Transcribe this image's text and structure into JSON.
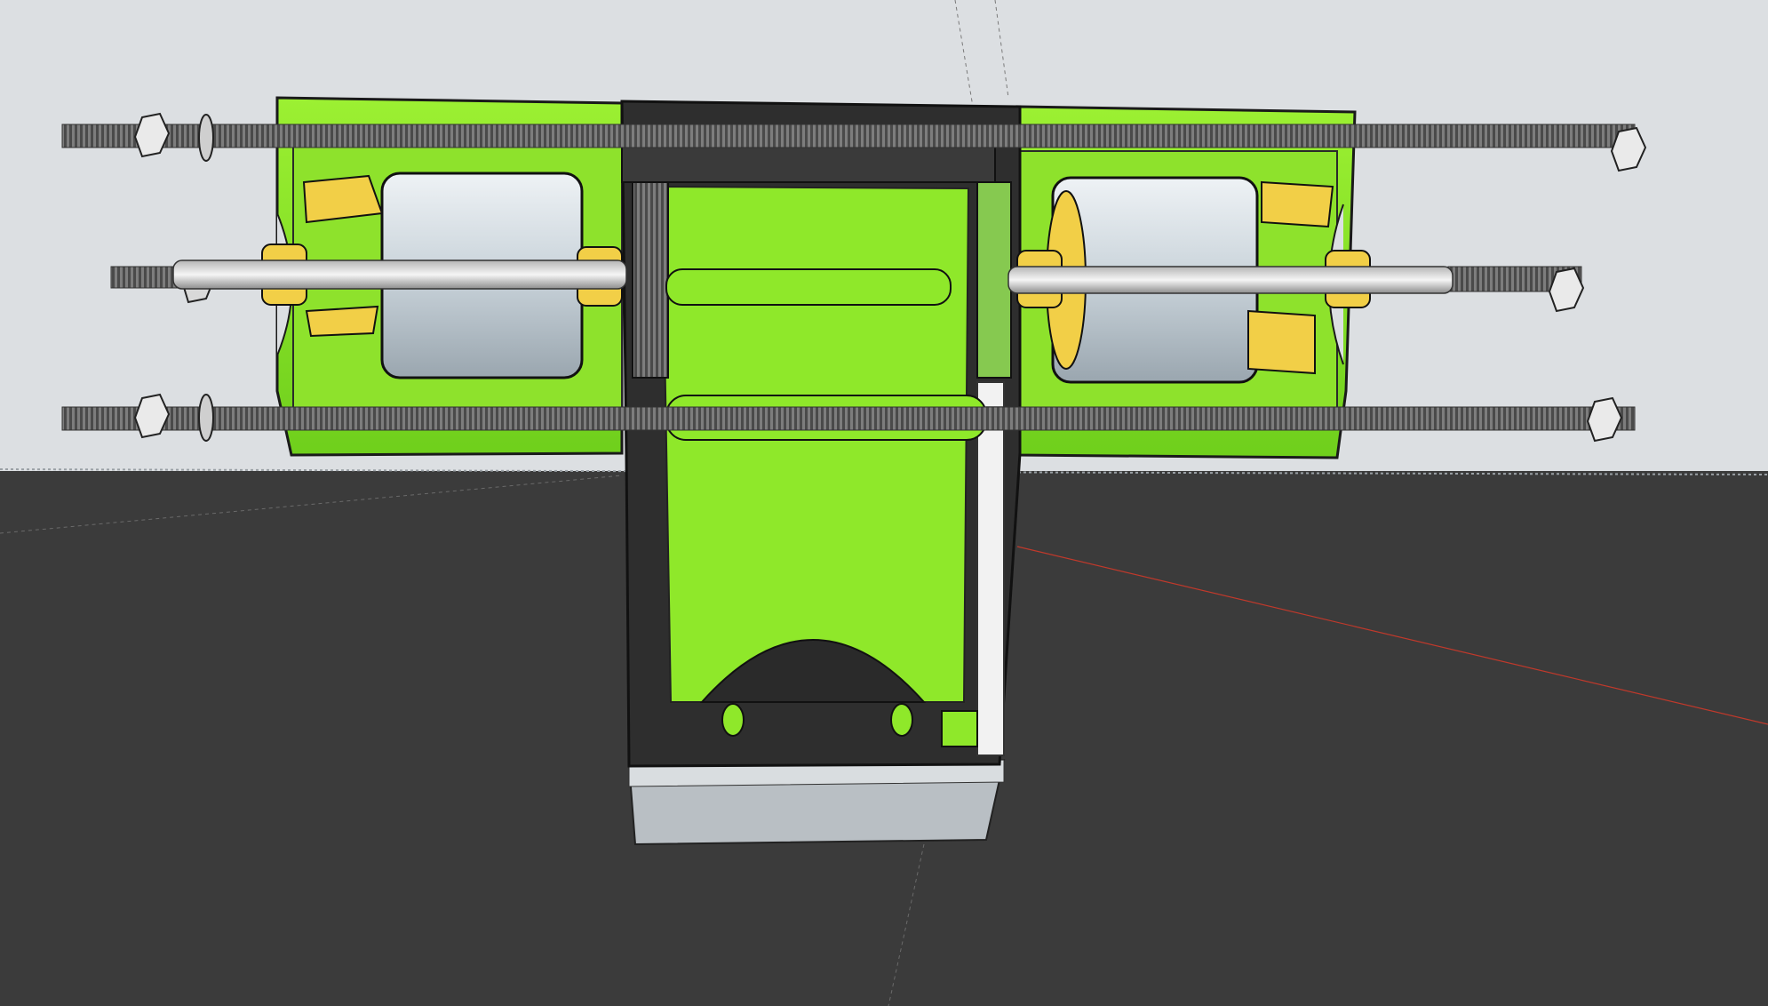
{
  "app": {
    "window_title": ""
  },
  "scene": {
    "sky_color": "#dcdfe2",
    "ground_color": "#3b3b3b",
    "part_green": "#8fe82a",
    "part_green_dark": "#5fbf18",
    "coupler_yellow": "#f2cf47",
    "motor_grey": "#cfd6dc",
    "rod_grey": "#8a8a8a",
    "red_axis_color": "#c0392b",
    "components": [
      "left-motor-housing",
      "right-motor-housing",
      "center-gearbox",
      "threaded-rod-top",
      "threaded-rod-middle",
      "threaded-rod-bottom",
      "left-motor",
      "right-motor",
      "gear-rack",
      "base-block"
    ]
  }
}
